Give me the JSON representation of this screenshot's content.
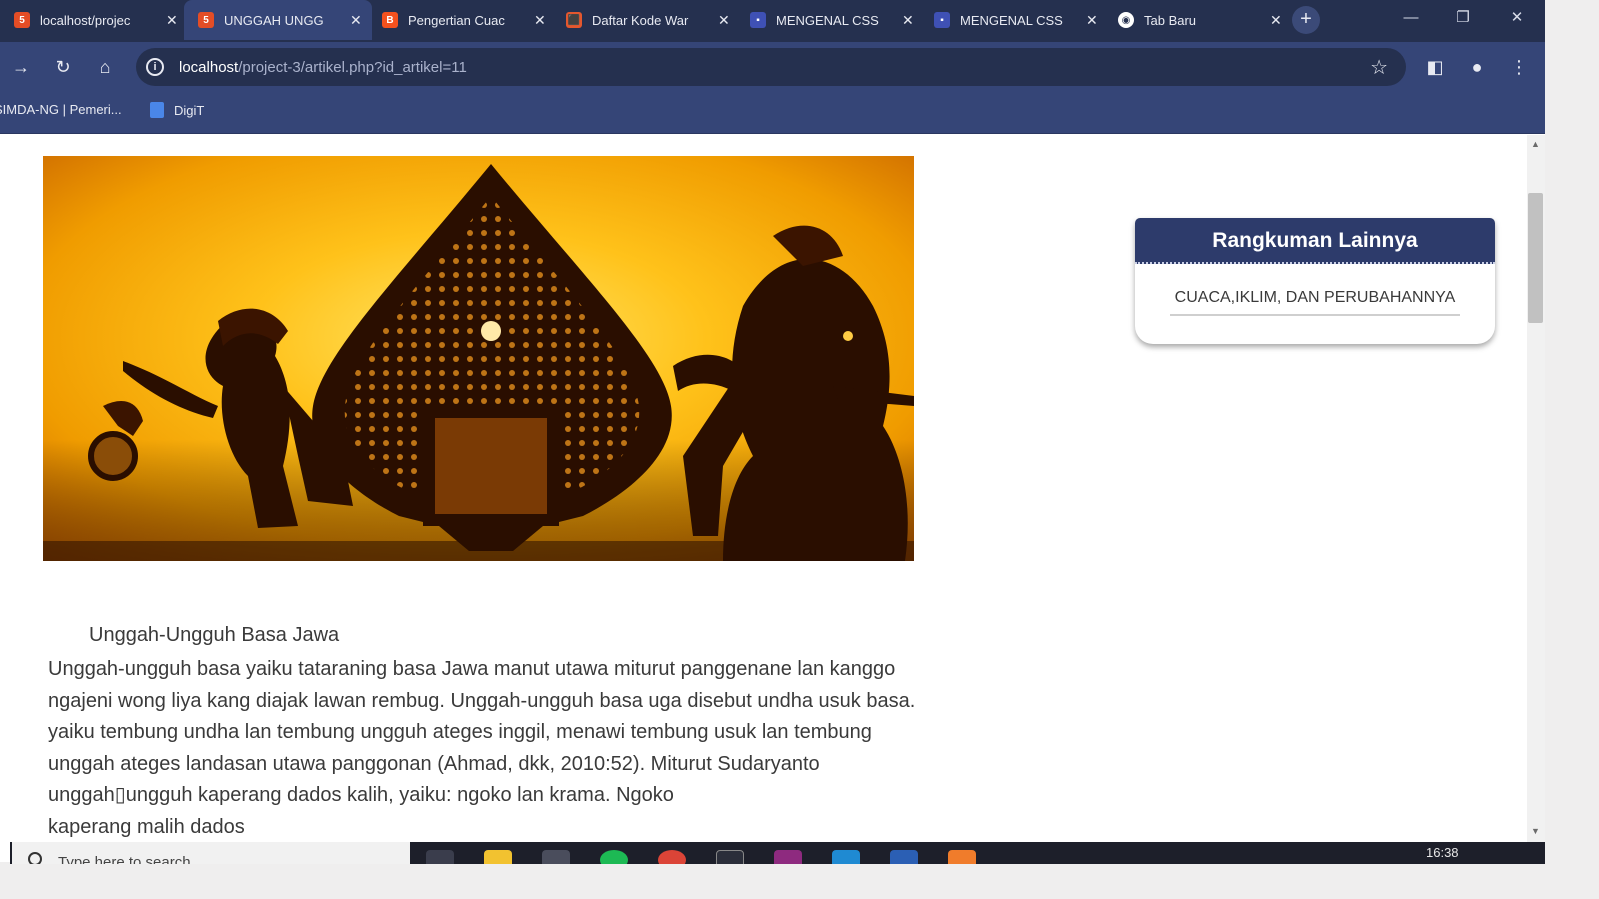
{
  "browser": {
    "tabs": [
      {
        "title": "localhost/projec",
        "icon": "html-file-icon",
        "color": "#e44d26",
        "active": false
      },
      {
        "title": "UNGGAH UNGG",
        "icon": "html-file-icon",
        "color": "#e44d26",
        "active": true
      },
      {
        "title": "Pengertian Cuac",
        "icon": "blogger-icon",
        "color": "#f4511e",
        "active": false
      },
      {
        "title": "Daftar Kode War",
        "icon": "site-icon",
        "color": "#e4572e",
        "active": false
      },
      {
        "title": "MENGENAL CSS",
        "icon": "site-icon",
        "color": "#3f51b5",
        "active": false
      },
      {
        "title": "MENGENAL CSS",
        "icon": "site-icon",
        "color": "#3f51b5",
        "active": false
      },
      {
        "title": "Tab Baru",
        "icon": "chrome-icon",
        "color": "#ffffff",
        "active": false
      }
    ],
    "new_tab": "+",
    "url_host": "localhost",
    "url_path": "/project-3/artikel.php?id_artikel=11",
    "bookmarks": [
      {
        "label": "SIMDA-NG | Pemeri..."
      },
      {
        "label": "DigiT"
      }
    ]
  },
  "article": {
    "title": "Unggah-Ungguh Basa Jawa",
    "body_lines": [
      "Unggah-ungguh basa yaiku tataraning basa Jawa manut utawa miturut panggenane lan kanggo",
      "ngajeni wong liya kang diajak lawan rembug. Unggah-ungguh basa uga disebut undha usuk basa.",
      "yaiku tembung undha lan tembung ungguh ateges inggil, menawi tembung usuk lan tembung",
      "unggah ateges landasan utawa panggonan (Ahmad, dkk, 2010:52). Miturut Sudaryanto",
      "unggah▯ungguh kaperang dados kalih, yaiku: ngoko lan krama. Ngoko",
      "kaperang malih dados"
    ]
  },
  "sidebar": {
    "title": "Rangkuman Lainnya",
    "items": [
      "CUACA,IKLIM, DAN PERUBAHANNYA"
    ]
  },
  "taskbar": {
    "search_placeholder": "Type here to search",
    "clock": "16:38",
    "apps": [
      "task-view",
      "file-explorer",
      "chrome",
      "spotify",
      "chrome",
      "terminal",
      "winrar",
      "vscode",
      "word",
      "xampp"
    ]
  },
  "colors": {
    "chrome_dark": "#25304f",
    "chrome_mid": "#354577",
    "card_header": "#2d3b6b"
  }
}
